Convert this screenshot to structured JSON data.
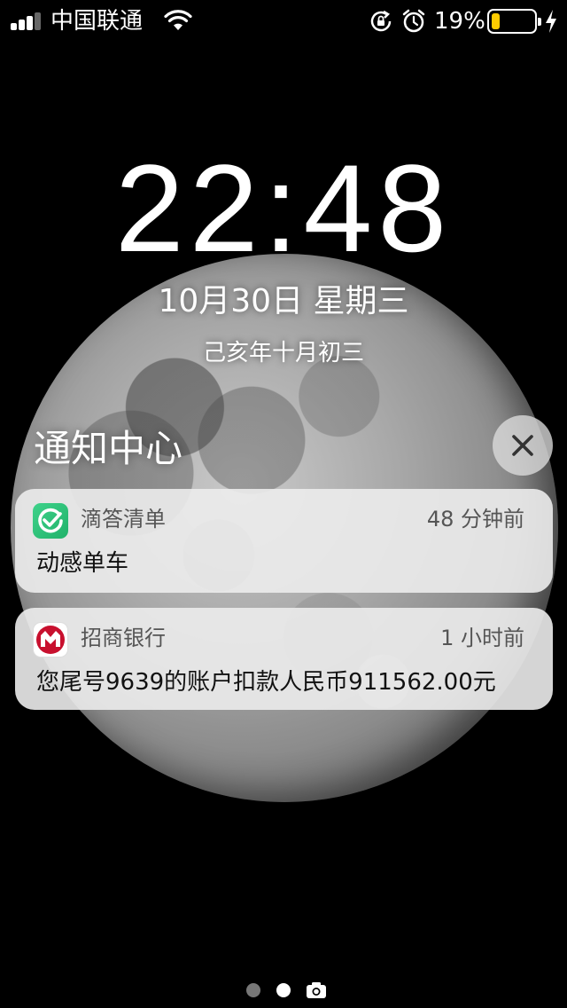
{
  "status_bar": {
    "carrier": "中国联通",
    "battery_percent": "19%",
    "battery_level": 0.19,
    "icons": [
      "signal-icon",
      "wifi-icon",
      "rotation-lock-icon",
      "alarm-icon",
      "battery-icon",
      "charging-bolt-icon"
    ]
  },
  "lock_screen": {
    "time": "22:48",
    "date": "10月30日 星期三",
    "lunar_date": "己亥年十月初三"
  },
  "notification_center": {
    "title": "通知中心",
    "clear_icon": "close-icon",
    "notifications": [
      {
        "app": "滴答清单",
        "icon": "ticktick-icon",
        "time": "48 分钟前",
        "body": "动感单车",
        "icon_color": "#2fc27a"
      },
      {
        "app": "招商银行",
        "icon": "cmb-bank-icon",
        "time": "1 小时前",
        "body": "您尾号9639的账户扣款人民币911562.00元",
        "icon_color": "#c8102e"
      }
    ]
  },
  "pager": {
    "pages": 3,
    "active_index": 1,
    "last_icon": "camera-icon"
  },
  "colors": {
    "battery_fill": "#ffcc00",
    "notification_bg": "#ececec"
  }
}
